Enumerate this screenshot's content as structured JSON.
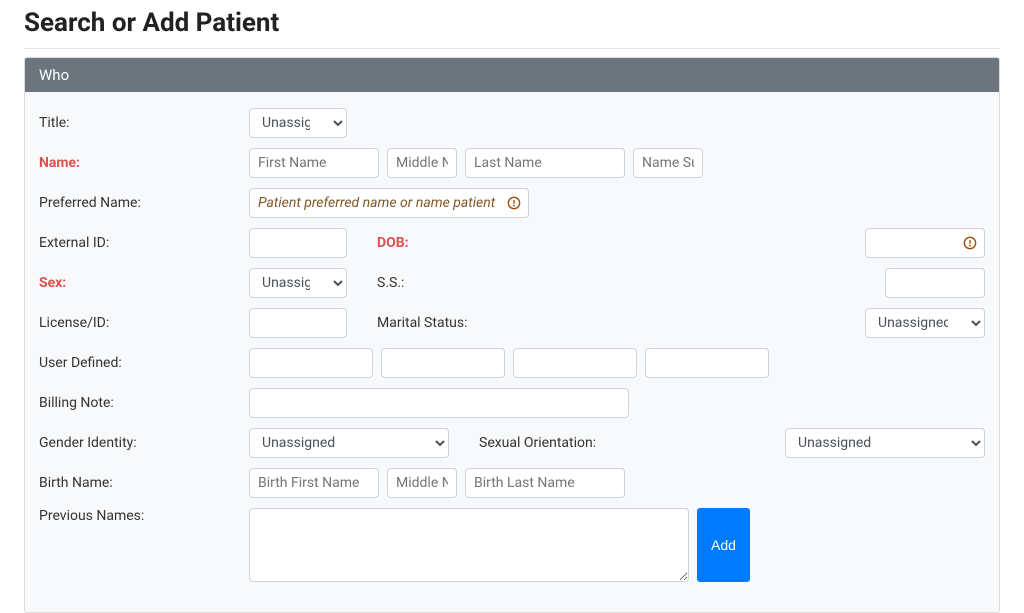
{
  "page": {
    "title": "Search or Add Patient"
  },
  "panel": {
    "header": "Who"
  },
  "labels": {
    "title": "Title:",
    "name": "Name:",
    "preferred_name": "Preferred Name:",
    "external_id": "External ID:",
    "dob": "DOB:",
    "sex": "Sex:",
    "ss": "S.S.:",
    "license_id": "License/ID:",
    "marital_status": "Marital Status:",
    "user_defined": "User Defined:",
    "billing_note": "Billing Note:",
    "gender_identity": "Gender Identity:",
    "sexual_orientation": "Sexual Orientation:",
    "birth_name": "Birth Name:",
    "previous_names": "Previous Names:"
  },
  "fields": {
    "title": {
      "selected": "Unassigned"
    },
    "first_name": {
      "placeholder": "First Name",
      "value": ""
    },
    "middle_name": {
      "placeholder": "Middle Na",
      "value": ""
    },
    "last_name": {
      "placeholder": "Last Name",
      "value": ""
    },
    "name_suffix": {
      "placeholder": "Name Suf",
      "value": ""
    },
    "preferred_name": {
      "placeholder": "Patient preferred name or name patient",
      "value": ""
    },
    "external_id": {
      "value": ""
    },
    "dob": {
      "value": ""
    },
    "sex": {
      "selected": "Unassigned"
    },
    "ss": {
      "value": ""
    },
    "license_id": {
      "value": ""
    },
    "marital_status": {
      "selected": "Unassigned"
    },
    "user_defined_1": {
      "value": ""
    },
    "user_defined_2": {
      "value": ""
    },
    "user_defined_3": {
      "value": ""
    },
    "user_defined_4": {
      "value": ""
    },
    "billing_note": {
      "value": ""
    },
    "gender_identity": {
      "selected": "Unassigned"
    },
    "sexual_orientation": {
      "selected": "Unassigned"
    },
    "birth_first_name": {
      "placeholder": "Birth First Name",
      "value": ""
    },
    "birth_middle_name": {
      "placeholder": "Middle Na",
      "value": ""
    },
    "birth_last_name": {
      "placeholder": "Birth Last Name",
      "value": ""
    },
    "previous_names": {
      "value": ""
    }
  },
  "buttons": {
    "add": "Add"
  },
  "colors": {
    "panel_header_bg": "#6c757d",
    "invalid_bg": "#f0950c",
    "required_label": "#d9534f",
    "primary_btn": "#007bff"
  }
}
